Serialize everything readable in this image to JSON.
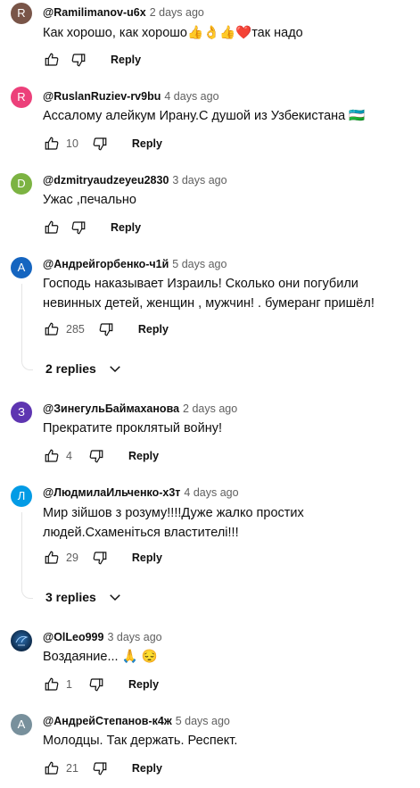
{
  "comments": [
    {
      "avatar_letter": "R",
      "avatar_color": "#795548",
      "author": "@Ramilimanov-u6x",
      "time": "2 days ago",
      "text": "Как хорошо, как хорошо👍👌👍❤️так надо",
      "likes": "",
      "reply_label": "Reply"
    },
    {
      "avatar_letter": "R",
      "avatar_color": "#ec407a",
      "author": "@RuslanRuziev-rv9bu",
      "time": "4 days ago",
      "text": "Ассалому алейкум Ирану.С душой из Узбекистана 🇺🇿",
      "likes": "10",
      "reply_label": "Reply"
    },
    {
      "avatar_letter": "D",
      "avatar_color": "#7cb342",
      "author": "@dzmitryaudzeyeu2830",
      "time": "3 days ago",
      "text": "Ужас ,печально",
      "likes": "",
      "reply_label": "Reply"
    },
    {
      "avatar_letter": "А",
      "avatar_color": "#1565c0",
      "author": "@Андрейгорбенко-ч1й",
      "time": "5 days ago",
      "text": "Господь наказывает Израиль! Сколько они погубили невинных детей, женщин , мужчин! . бумеранг пришёл!",
      "likes": "285",
      "reply_label": "Reply",
      "replies_label": "2 replies"
    },
    {
      "avatar_letter": "З",
      "avatar_color": "#5e35b1",
      "author": "@ЗинегульБаймаханова",
      "time": "2 days ago",
      "text": "Прекратите проклятый войну!",
      "likes": "4",
      "reply_label": "Reply"
    },
    {
      "avatar_letter": "Л",
      "avatar_color": "#039be5",
      "author": "@ЛюдмилаИльченко-х3т",
      "time": "4 days ago",
      "text": "Мир зійшов з розуму!!!!Дуже жалко простих людей.Схаменіться властителі!!!",
      "likes": "29",
      "reply_label": "Reply",
      "replies_label": "3 replies"
    },
    {
      "avatar_letter": "",
      "avatar_color": "#0d2a4a",
      "author": "@OlLeo999",
      "time": "3 days ago",
      "text": "Воздаяние... 🙏 😔",
      "likes": "1",
      "reply_label": "Reply"
    },
    {
      "avatar_letter": "А",
      "avatar_color": "#78909c",
      "author": "@АндрейСтепанов-к4ж",
      "time": "5 days ago",
      "text": "Молодцы. Так держать. Респект.",
      "likes": "21",
      "reply_label": "Reply"
    }
  ],
  "icons": {
    "like": "thumb-up-icon",
    "dislike": "thumb-down-icon",
    "expand": "chevron-down-icon"
  },
  "colors": {
    "secondary_text": "#606060",
    "thread_line": "#e5e5e5"
  }
}
